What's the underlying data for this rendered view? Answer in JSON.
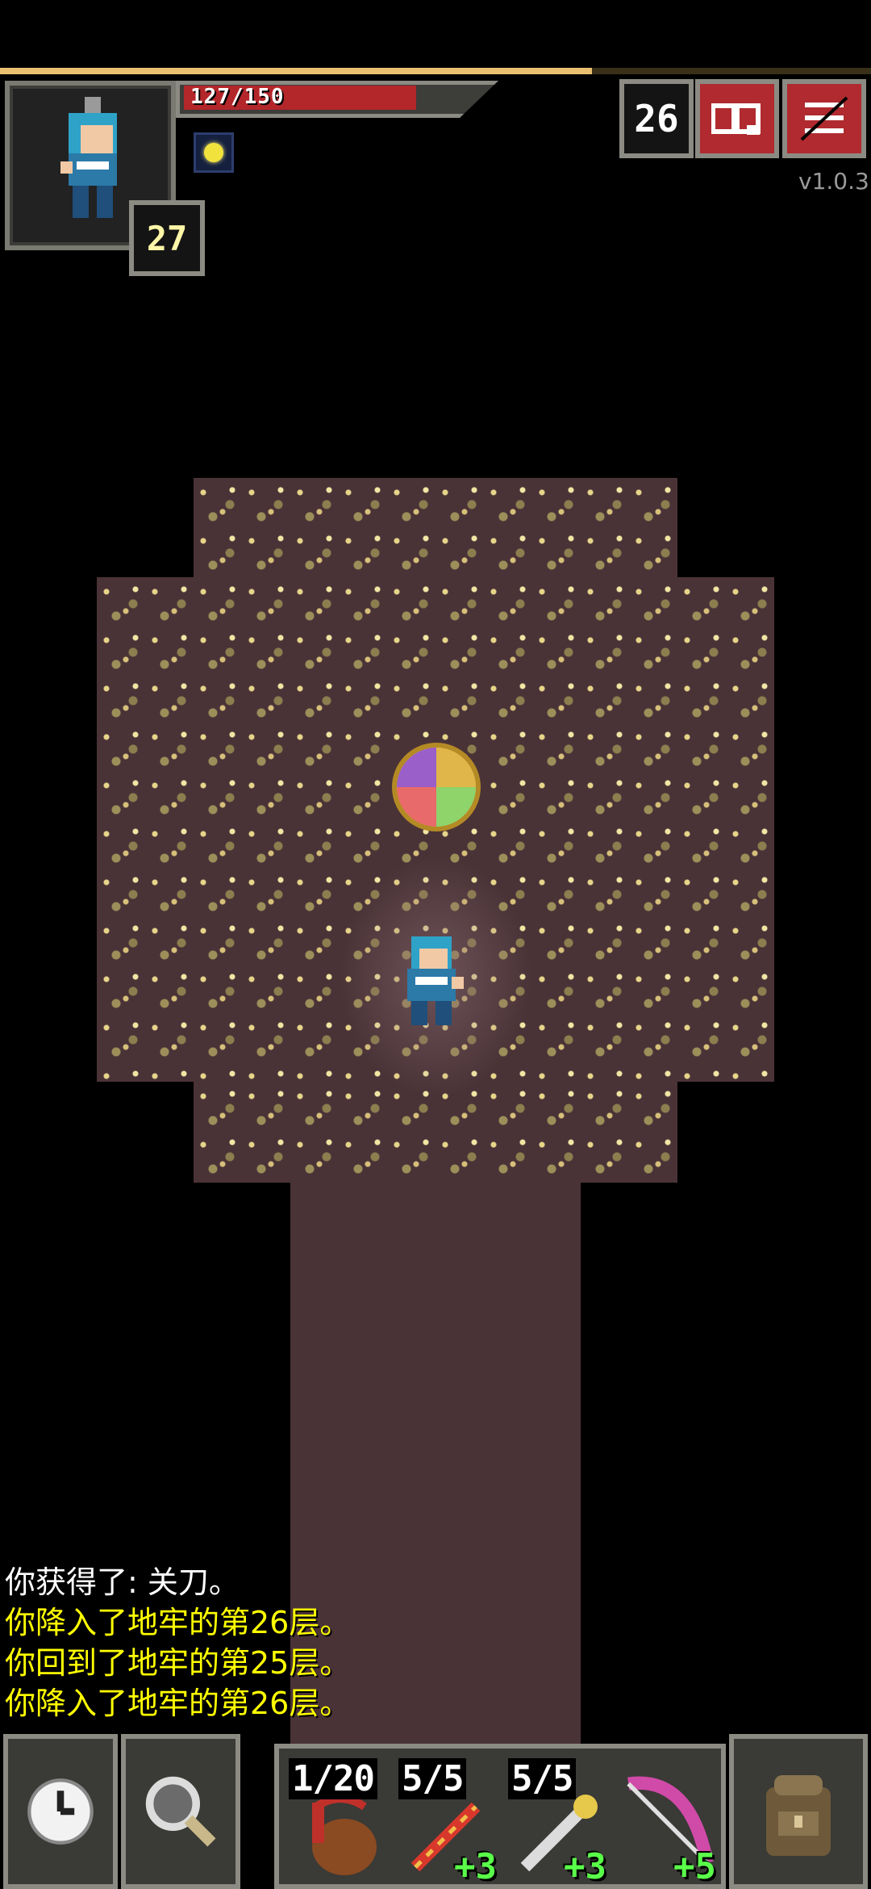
{
  "status": {
    "hp_text": "127/150",
    "hp_current": 127,
    "hp_max": 150,
    "experience_fraction": 0.68,
    "hero_level": "27",
    "depth": "26",
    "version": "v1.0.3"
  },
  "buffs": [
    {
      "icon": "light-buff-icon"
    }
  ],
  "buttons": {
    "journal": "journal-icon",
    "menu": "menu-icon",
    "wait": "clock-icon",
    "search": "magnifier-icon",
    "backpack": "backpack-icon"
  },
  "log": [
    {
      "text": "你获得了: 关刀。",
      "color": "#ffffff"
    },
    {
      "text": "你降入了地牢的第26层。",
      "color": "#ffff00"
    },
    {
      "text": "你回到了地牢的第25层。",
      "color": "#ffff00"
    },
    {
      "text": "你降入了地牢的第26层。",
      "color": "#ffff00"
    }
  ],
  "quickslots": [
    {
      "item": "waterskin-icon",
      "count": "1/20",
      "bonus": ""
    },
    {
      "item": "fire-wand-icon",
      "count": "5/5",
      "bonus": "+3"
    },
    {
      "item": "lightning-wand-icon",
      "count": "5/5",
      "bonus": "+3"
    },
    {
      "item": "bow-icon",
      "count": "",
      "bonus": "+5"
    }
  ],
  "colors": {
    "hp_bar": "#b3262a",
    "button_red": "#b02a2f",
    "log_highlight": "#ffff00",
    "bonus_green": "#5aff4a"
  }
}
